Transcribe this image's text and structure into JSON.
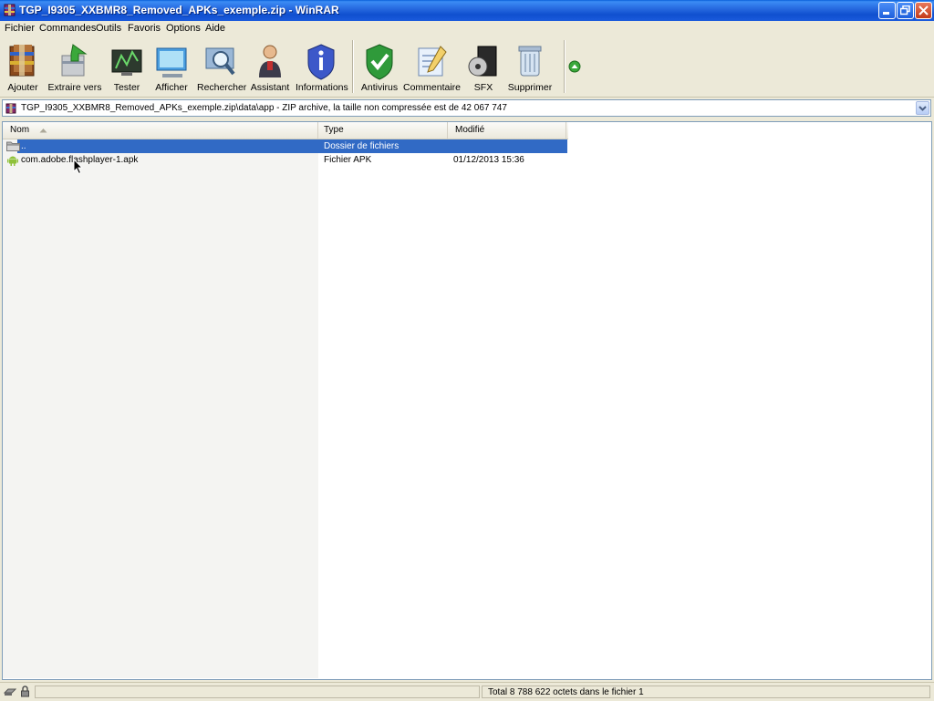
{
  "window": {
    "title": "TGP_I9305_XXBMR8_Removed_APKs_exemple.zip - WinRAR"
  },
  "menu": [
    "Fichier",
    "Commandes",
    "Outils",
    "Favoris",
    "Options",
    "Aide"
  ],
  "toolbar": [
    {
      "label": "Ajouter",
      "icon": "add-archive-icon"
    },
    {
      "label": "Extraire vers",
      "icon": "extract-icon"
    },
    {
      "label": "Tester",
      "icon": "test-icon"
    },
    {
      "label": "Afficher",
      "icon": "view-icon"
    },
    {
      "label": "Rechercher",
      "icon": "find-icon"
    },
    {
      "label": "Assistant",
      "icon": "wizard-icon"
    },
    {
      "label": "Informations",
      "icon": "info-icon"
    },
    {
      "label": "Antivirus",
      "icon": "antivirus-icon"
    },
    {
      "label": "Commentaire",
      "icon": "comment-icon"
    },
    {
      "label": "SFX",
      "icon": "sfx-icon"
    },
    {
      "label": "Supprimer",
      "icon": "delete-icon"
    }
  ],
  "path": {
    "text": "TGP_I9305_XXBMR8_Removed_APKs_exemple.zip\\data\\app - ZIP archive, la taille non compressée est de 42 067 747"
  },
  "columns": {
    "name": "Nom",
    "type": "Type",
    "modified": "Modifié"
  },
  "rows": [
    {
      "name": "..",
      "type": "Dossier de fichiers",
      "modified": "",
      "selected": true
    },
    {
      "name": "com.adobe.flashplayer-1.apk",
      "type": "Fichier APK",
      "modified": "01/12/2013 15:36",
      "selected": false
    }
  ],
  "status": {
    "left": "",
    "right": "Total 8 788 622 octets dans le fichier 1"
  },
  "colors": {
    "titlebar": "#2466dd",
    "selection": "#316ac5",
    "chrome": "#ece9d8"
  }
}
